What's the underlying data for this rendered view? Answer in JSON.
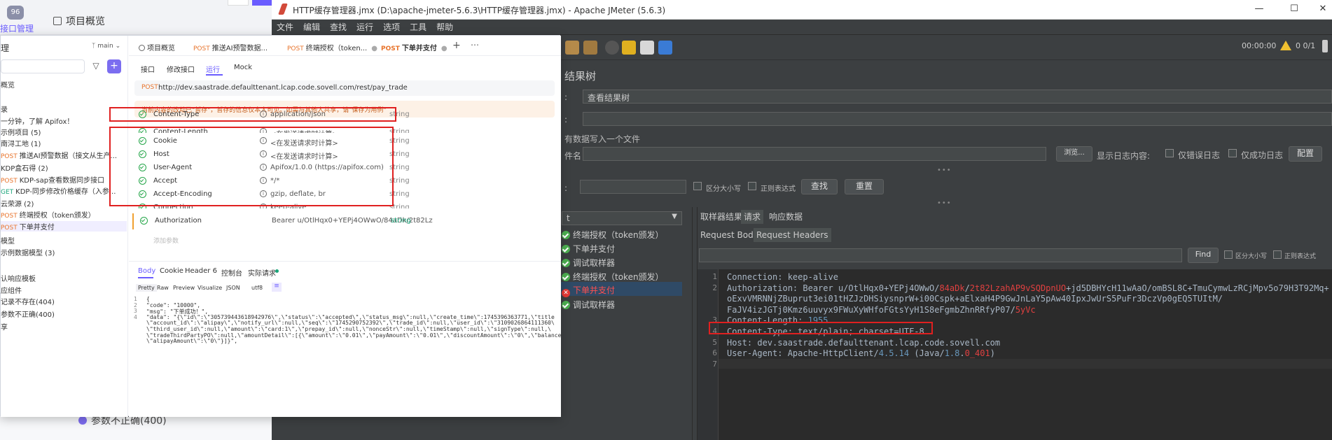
{
  "back": {
    "badge": "96",
    "menu_label": "接口管理",
    "project_title": "项目概览",
    "bottom_text": "参数不正确(400)"
  },
  "jmeter": {
    "title": "HTTP缓存管理器.jmx (D:\\apache-jmeter-5.6.3\\HTTP缓存管理器.jmx) - Apache JMeter (5.6.3)",
    "menu": [
      "文件",
      "编辑",
      "查找",
      "运行",
      "选项",
      "工具",
      "帮助"
    ],
    "timer": "00:00:00",
    "count": "0 0/1",
    "panel_title": "结果树",
    "name_label": ":",
    "name_value": "查看结果树",
    "comment_label": ":",
    "file_section": "有数据写入一个文件",
    "file_name_label": "件名",
    "browse": "浏览...",
    "log_content": "显示日志内容:",
    "only_errors": "仅错误日志",
    "only_success": "仅成功日志",
    "config": "配置",
    "search_label": ":",
    "case_sensitive": "区分大小写",
    "regex": "正则表达式",
    "find": "查找",
    "reset": "重置",
    "tree_dropdown": "t",
    "tree_items": [
      {
        "label": "终端授权（token颁发）",
        "status": "ok"
      },
      {
        "label": "下单并支付",
        "status": "ok"
      },
      {
        "label": "调试取样器",
        "status": "ok"
      },
      {
        "label": "终端授权（token颁发）",
        "status": "ok"
      },
      {
        "label": "下单并支付",
        "status": "error"
      },
      {
        "label": "调试取样器",
        "status": "ok"
      }
    ],
    "result_tabs": [
      "取样器结果",
      "请求",
      "响应数据"
    ],
    "sub_tabs": [
      "Request Body",
      "Request Headers"
    ],
    "find_btn": "Find",
    "case_sensitive2": "区分大小写",
    "regex2": "正则表达式",
    "code_lines": [
      {
        "n": "1",
        "parts": [
          [
            "Connection: keep-alive",
            ""
          ]
        ]
      },
      {
        "n": "2",
        "parts": [
          [
            "Authorization: Bearer u/OtlHqx0+YEPj4OWwO/",
            ""
          ],
          [
            "84aDk",
            "red"
          ],
          [
            "/",
            ""
          ],
          [
            "2t82LzahAP9vSQDpnUO",
            "red"
          ],
          [
            "+jd5DBHYcH11wAaO/omBSL8C+TmuCymwLzRCjMpv5o79H3T92Mq+",
            ""
          ]
        ]
      },
      {
        "n": "",
        "parts": [
          [
            "oExvVMRNNjZBuprut3ei01tHZJzDHSiysnprW+i00Cspk+aElxaH4P9GwJnLaY5pAw40IpxJwUrS5PuFr3DczVp0gEQ5TUItM/",
            ""
          ]
        ]
      },
      {
        "n": "",
        "parts": [
          [
            "FaJV4izJGTj0Kmz6uuvyx9FWuXyWHfoFGtsYyH1S8eFgmbZhnRRfyP07/",
            ""
          ],
          [
            "5yVc",
            "red"
          ]
        ]
      },
      {
        "n": "3",
        "parts": [
          [
            "Content-Length: ",
            ""
          ],
          [
            "1955",
            "blue"
          ]
        ]
      },
      {
        "n": "4",
        "parts": [
          [
            "Content-Type: text/plain; charset=UTF-8",
            ""
          ]
        ]
      },
      {
        "n": "5",
        "parts": [
          [
            "Host: dev.saastrade.defaulttenant.lcap.code.sovell.com",
            ""
          ]
        ]
      },
      {
        "n": "6",
        "parts": [
          [
            "User-Agent: Apache-HttpClient/",
            ""
          ],
          [
            "4.5.14",
            "blue"
          ],
          [
            " (Java/",
            ""
          ],
          [
            "1.8",
            "blue"
          ],
          [
            ".",
            ""
          ],
          [
            "0_401",
            "red"
          ],
          [
            ")",
            ""
          ]
        ]
      },
      {
        "n": "7",
        "parts": [
          [
            "",
            ""
          ]
        ]
      }
    ]
  },
  "apifox": {
    "sidebar_title": "理",
    "branch": "main",
    "sidebar_items": [
      {
        "label": "概览",
        "method": ""
      },
      {
        "label": "",
        "method": ""
      },
      {
        "label": "录",
        "method": ""
      },
      {
        "label": "一分钟，了解 Apifox！",
        "method": ""
      },
      {
        "label": "示例项目 (5)",
        "method": ""
      },
      {
        "label": "南浔工地 (1)",
        "method": ""
      },
      {
        "label": "推送AI预警数据（接文从生产...",
        "method": "POST"
      },
      {
        "label": "KDP盒石得 (2)",
        "method": ""
      },
      {
        "label": "KDP-sap查看数据同步接口",
        "method": "POST"
      },
      {
        "label": "KDP-同步修改价格缓存（入参...",
        "method": "GET"
      },
      {
        "label": "云荣源 (2)",
        "method": ""
      },
      {
        "label": "终端授权（token颁发）",
        "method": "POST"
      },
      {
        "label": "下单并支付",
        "method": "POST"
      },
      {
        "label": "模型",
        "method": ""
      },
      {
        "label": "示例数据模型 (3)",
        "method": ""
      },
      {
        "label": "",
        "method": ""
      },
      {
        "label": "认响应模板",
        "method": ""
      },
      {
        "label": "应组件",
        "method": ""
      },
      {
        "label": "记录不存在(404)",
        "method": ""
      },
      {
        "label": "参数不正确(400)",
        "method": ""
      },
      {
        "label": "享",
        "method": ""
      }
    ],
    "tabs": [
      {
        "method": "",
        "label": "项目概览"
      },
      {
        "method": "POST",
        "label": "推送AI预警数据..."
      },
      {
        "method": "POST",
        "label": "终端授权（token..."
      },
      {
        "method": "POST",
        "label": "下单并支付"
      }
    ],
    "subtabs": [
      "接口",
      "修改接口",
      "运行",
      "Mock"
    ],
    "url_method": "POST",
    "url": "http://dev.saastrade.defaulttenant.lcap.code.sovell.com/rest/pay_trade",
    "notice": "当前内容的改动已\"暂存\"，暂存的信息仅本人可见。如需与其他人共享，请\"保存为用例\"",
    "headers": [
      {
        "key": "Content-Type",
        "value": "application/json",
        "type": "string"
      },
      {
        "key": "Content-Length",
        "value": "<在发送请求时计算>",
        "type": "string"
      },
      {
        "key": "Cookie",
        "value": "<在发送请求时计算>",
        "type": "string"
      },
      {
        "key": "Host",
        "value": "<在发送请求时计算>",
        "type": "string"
      },
      {
        "key": "User-Agent",
        "value": "Apifox/1.0.0 (https://apifox.com)",
        "type": "string"
      },
      {
        "key": "Accept",
        "value": "*/*",
        "type": "string"
      },
      {
        "key": "Accept-Encoding",
        "value": "gzip, deflate, br",
        "type": "string"
      },
      {
        "key": "Connection",
        "value": "keep-alive",
        "type": "string"
      },
      {
        "key": "Authorization",
        "value": "Bearer u/OtlHqx0+YEPj4OWwO/84aDk/2t82Lz",
        "type": "string"
      }
    ],
    "add_param": "添加参数",
    "body_tabs": [
      "Body",
      "Cookie",
      "Header 6",
      "控制台",
      "实际请求"
    ],
    "view_tabs": [
      "Pretty",
      "Raw",
      "Preview",
      "Visualize",
      "JSON",
      "utf8"
    ],
    "resp_lines": [
      {
        "n": "1",
        "text": "{"
      },
      {
        "n": "2",
        "text": "    \"code\": \"10000\","
      },
      {
        "n": "3",
        "text": "    \"msg\": \"下单成功！\","
      },
      {
        "n": "4",
        "text": "    \"data\": \"{\\\"id\\\":\\\"305739443618942976\\\",\\\"status\\\":\\\"accepted\\\",\\\"status_msg\\\":null,\\\"create_time\\\":1745396363771,\\\"title"
      },
      {
        "n": "",
        "text": "    \\\"account_id\\\":\\\"alipay\\\",\\\"notify_url\\\":null,\\\"seq\\\":\\\"1745290752392\\\",\\\"trade_id\\\":null,\\\"user_id\\\":\\\"3109026864111360\\"
      },
      {
        "n": "",
        "text": "    \\\"third_user_id\\\":null,\\\"amount\\\":\\\"card:1\\\",\\\"prepay_id\\\":null,\\\"nonceStr\\\":null,\\\"timeStamp\\\":null,\\\"signType\\\":null,\\"
      },
      {
        "n": "",
        "text": "    \\\"tradeThirdPartyPO\\\":null,\\\"amountDetail\\\":[{\\\"amount\\\":\\\"0.01\\\",\\\"payAmount\\\":\\\"0.01\\\",\\\"discountAmount\\\":\\\"0\\\",\\\"balance"
      },
      {
        "n": "",
        "text": "    \\\"alipayAmount\\\":\\\"0\\\"}]}\","
      }
    ]
  }
}
